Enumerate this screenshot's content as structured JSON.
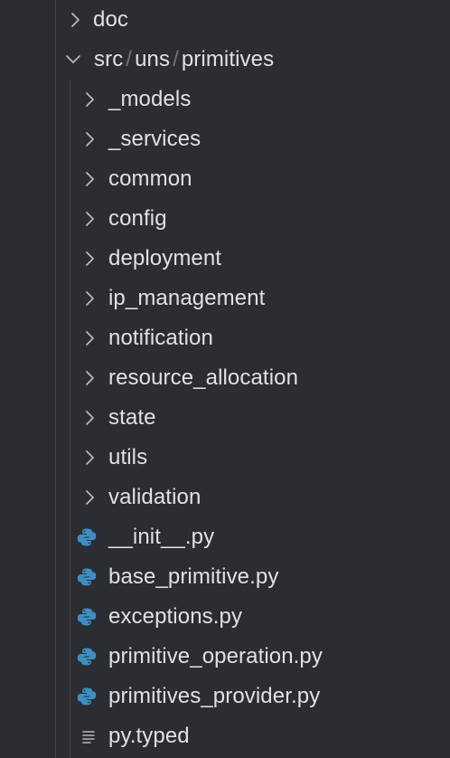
{
  "tree": {
    "top_folder": {
      "label": "doc",
      "icon": "chevron-right-icon",
      "expanded": false
    },
    "open_path": {
      "parts": [
        "src",
        "uns",
        "primitives"
      ],
      "separator": "/",
      "icon": "chevron-down-icon",
      "expanded": true
    },
    "folders": [
      {
        "label": "_models",
        "icon": "chevron-right-icon"
      },
      {
        "label": "_services",
        "icon": "chevron-right-icon"
      },
      {
        "label": "common",
        "icon": "chevron-right-icon"
      },
      {
        "label": "config",
        "icon": "chevron-right-icon"
      },
      {
        "label": "deployment",
        "icon": "chevron-right-icon"
      },
      {
        "label": "ip_management",
        "icon": "chevron-right-icon"
      },
      {
        "label": "notification",
        "icon": "chevron-right-icon"
      },
      {
        "label": "resource_allocation",
        "icon": "chevron-right-icon"
      },
      {
        "label": "state",
        "icon": "chevron-right-icon"
      },
      {
        "label": "utils",
        "icon": "chevron-right-icon"
      },
      {
        "label": "validation",
        "icon": "chevron-right-icon"
      }
    ],
    "files": [
      {
        "label": "__init__.py",
        "icon": "python-file-icon"
      },
      {
        "label": "base_primitive.py",
        "icon": "python-file-icon"
      },
      {
        "label": "exceptions.py",
        "icon": "python-file-icon"
      },
      {
        "label": "primitive_operation.py",
        "icon": "python-file-icon"
      },
      {
        "label": "primitives_provider.py",
        "icon": "python-file-icon"
      },
      {
        "label": "py.typed",
        "icon": "text-file-icon"
      }
    ]
  },
  "colors": {
    "background": "#2b2d30",
    "text": "#dfe1e5",
    "chevron": "#b4b8bf",
    "guide_line": "#43454a",
    "separator": "#6f737a",
    "python_blue": "#3b8fc4",
    "python_dot": "#2b2d30"
  }
}
